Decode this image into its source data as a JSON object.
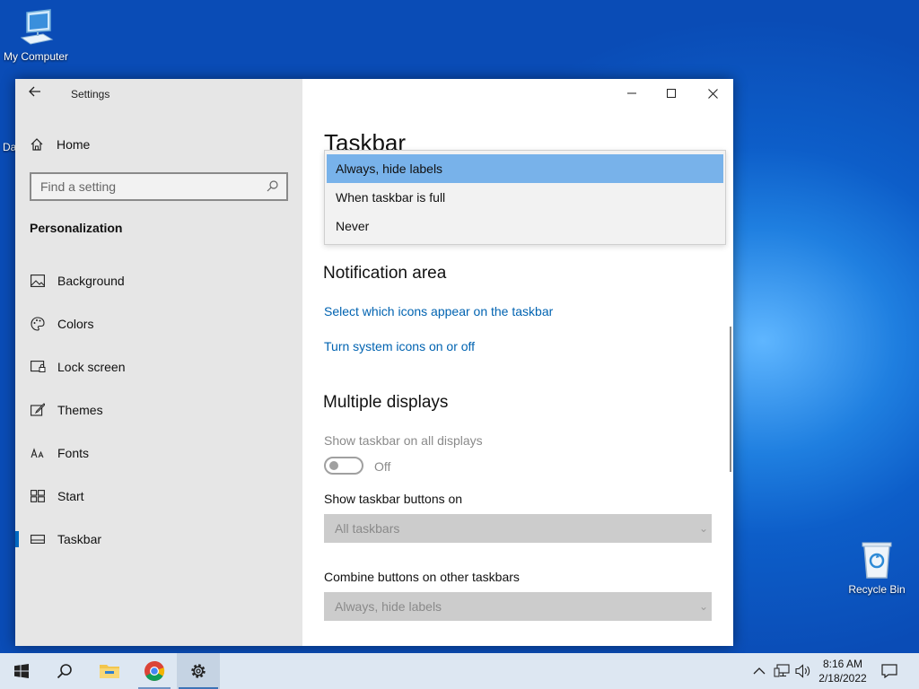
{
  "desktop": {
    "icons": [
      {
        "label": "My Computer"
      },
      {
        "label": "Recycle Bin"
      }
    ],
    "partial_label": "Dat"
  },
  "window": {
    "title": "Settings",
    "sidebar": {
      "home": "Home",
      "search_placeholder": "Find a setting",
      "section": "Personalization",
      "items": [
        {
          "label": "Background",
          "icon": "image-icon"
        },
        {
          "label": "Colors",
          "icon": "palette-icon"
        },
        {
          "label": "Lock screen",
          "icon": "lock-screen-icon"
        },
        {
          "label": "Themes",
          "icon": "brush-icon"
        },
        {
          "label": "Fonts",
          "icon": "font-icon"
        },
        {
          "label": "Start",
          "icon": "start-grid-icon"
        },
        {
          "label": "Taskbar",
          "icon": "taskbar-icon",
          "selected": true
        }
      ]
    },
    "main": {
      "page_title": "Taskbar",
      "dropdown_options": [
        "Always, hide labels",
        "When taskbar is full",
        "Never"
      ],
      "dropdown_selected": "Always, hide labels",
      "notification_area": {
        "heading": "Notification area",
        "link1": "Select which icons appear on the taskbar",
        "link2": "Turn system icons on or off"
      },
      "multiple_displays": {
        "heading": "Multiple displays",
        "show_all_label": "Show taskbar on all displays",
        "toggle_state": "Off",
        "buttons_on_label": "Show taskbar buttons on",
        "buttons_on_value": "All taskbars",
        "combine_label": "Combine buttons on other taskbars",
        "combine_value": "Always, hide labels"
      }
    }
  },
  "taskbar": {
    "pinned": [
      "start-icon",
      "search-icon",
      "file-explorer-icon",
      "chrome-icon",
      "settings-icon"
    ],
    "tray": [
      "chevron-up-icon",
      "network-icon",
      "volume-icon"
    ],
    "time": "8:16 AM",
    "date": "2/18/2022"
  },
  "colors": {
    "accent": "#0067c0",
    "link": "#0063b1",
    "dropdown_highlight": "#78b2ea",
    "sidebar_bg": "#e6e6e6",
    "taskbar_bg": "#dde7f2"
  }
}
